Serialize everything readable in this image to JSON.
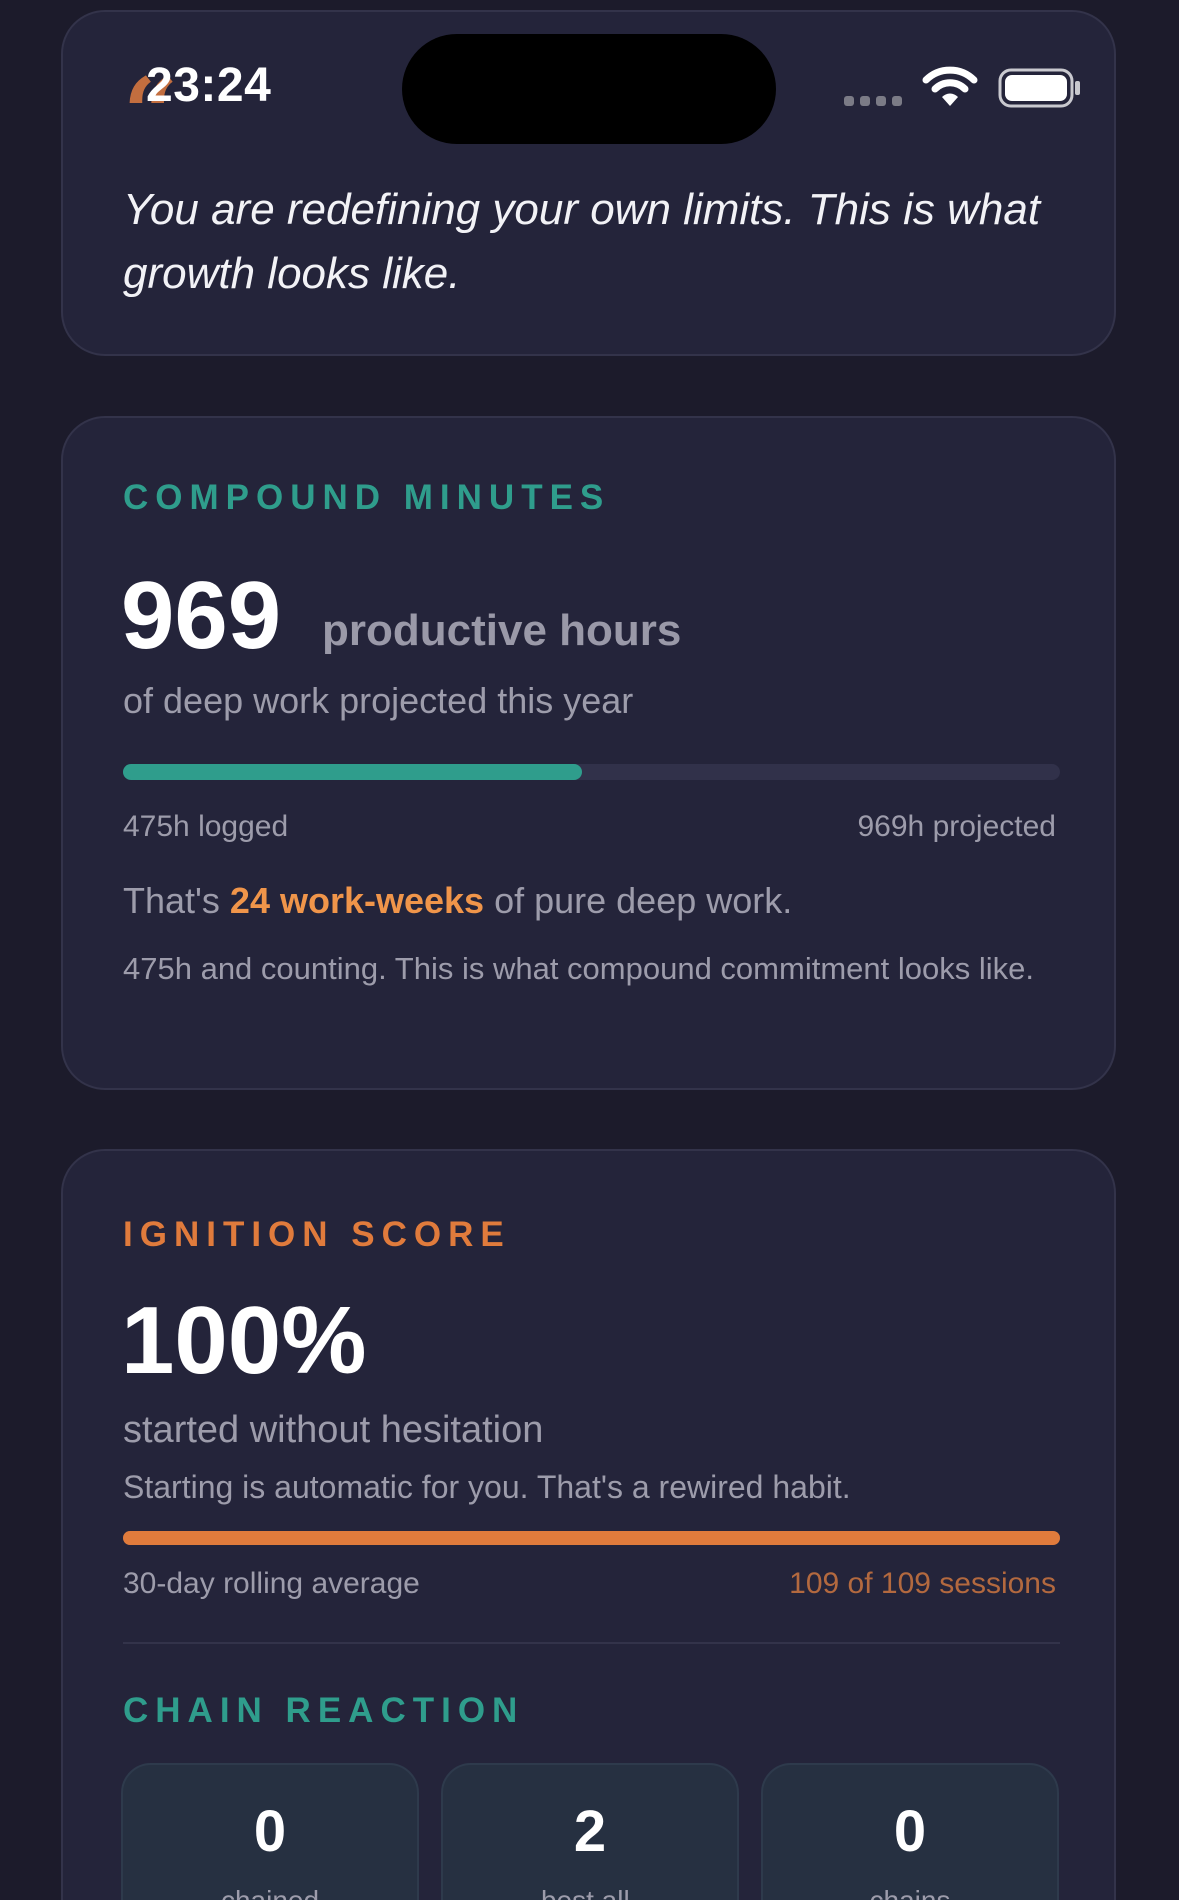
{
  "status_bar": {
    "time": "23:24"
  },
  "quote": {
    "mark": "“",
    "text": "You are redefining your own limits. This is what growth looks like."
  },
  "compound_minutes": {
    "label": "COMPOUND MINUTES",
    "value": "969",
    "suffix": "productive hours",
    "subtitle": "of deep work projected this year",
    "progress_fraction": 0.49,
    "logged_label": "475h logged",
    "projected_label": "969h projected",
    "weeks_prefix": "That's ",
    "weeks_highlight": "24 work-weeks",
    "weeks_suffix": " of pure deep work.",
    "note": "475h and counting. This is what compound commitment looks like."
  },
  "ignition_score": {
    "label": "IGNITION SCORE",
    "value": "100%",
    "subtitle": "started without hesitation",
    "note": "Starting is automatic for you. That's a rewired habit.",
    "progress_fraction": 1.0,
    "period_label": "30-day rolling average",
    "sessions_label": "109 of 109 sessions"
  },
  "chain_reaction": {
    "label": "CHAIN REACTION",
    "tiles": [
      {
        "value": "0",
        "label": "chained"
      },
      {
        "value": "2",
        "label": "best all-"
      },
      {
        "value": "0",
        "label": "chains"
      }
    ]
  },
  "colors": {
    "background": "#1c1b2b",
    "card": "#24243a",
    "teal_accent": "#2f9d8c",
    "orange_accent": "#e07b3c",
    "highlight": "#f0954a"
  }
}
